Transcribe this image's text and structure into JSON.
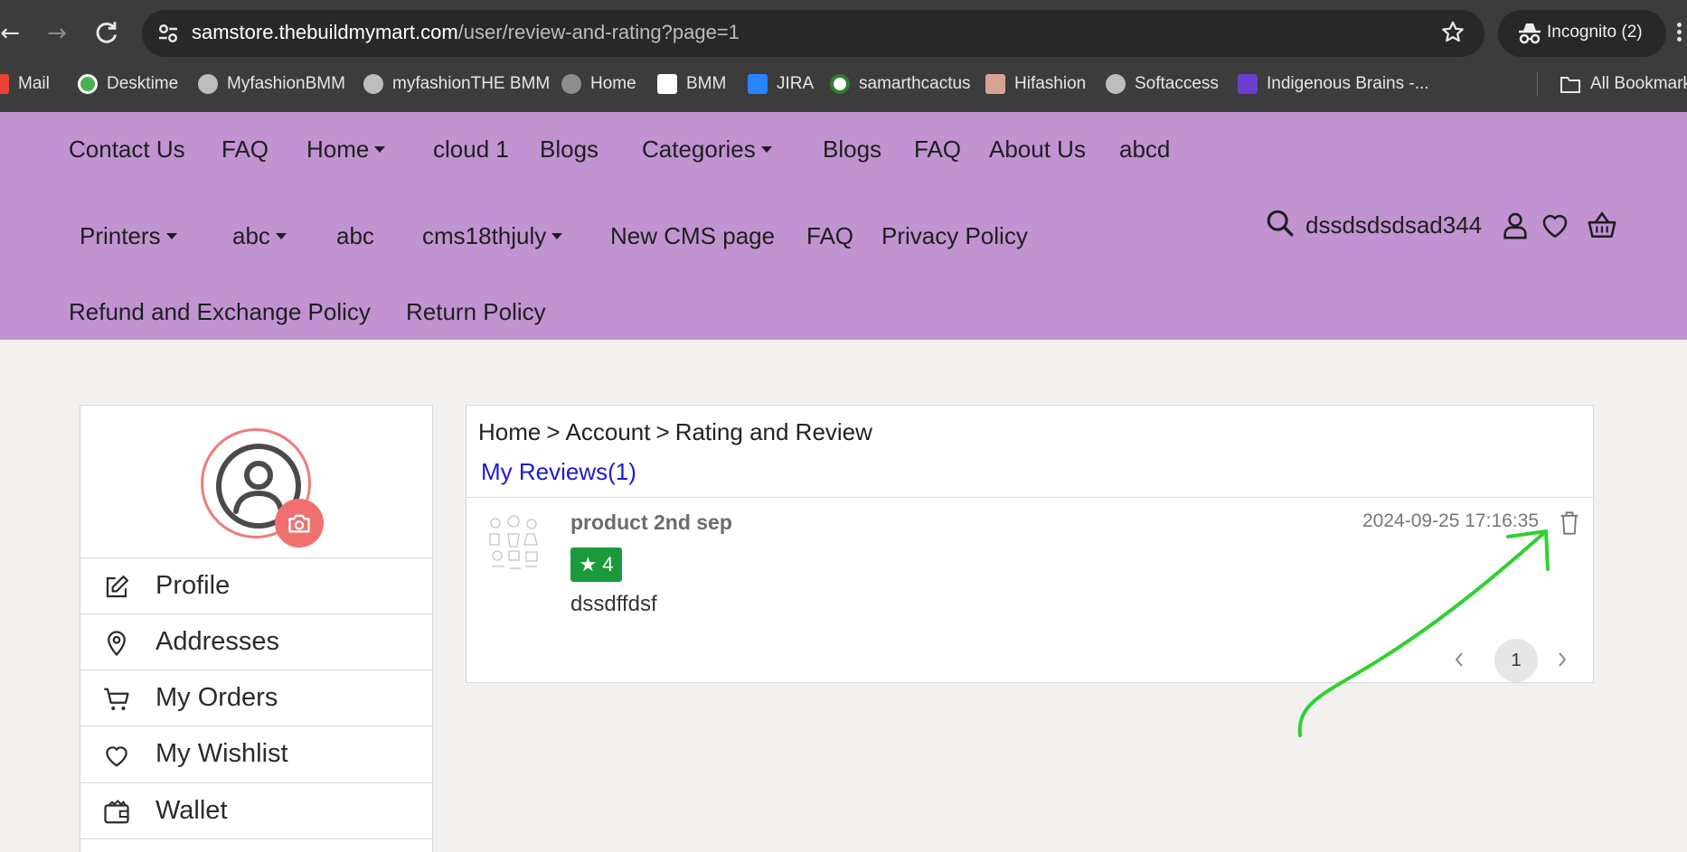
{
  "browser": {
    "url_host": "samstore.thebuildmymart.com",
    "url_path": "/user/review-and-rating?page=1",
    "incognito_label": "Incognito (2)",
    "bookmarks": [
      "Mail",
      "Desktime",
      "MyfashionBMM",
      "myfashionTHE BMM",
      "Home",
      "BMM",
      "JIRA",
      "samarthcactus",
      "Hifashion",
      "Softaccess",
      "Indigenous Brains -...",
      "All Bookmarks"
    ]
  },
  "header": {
    "row1": [
      "Contact Us",
      "FAQ",
      "Home",
      "cloud 1",
      "Blogs",
      "Categories",
      "Blogs",
      "FAQ",
      "About Us",
      "abcd"
    ],
    "row2": [
      "Printers",
      "abc",
      "abc",
      "cms18thjuly",
      "New CMS page",
      "FAQ",
      "Privacy Policy"
    ],
    "row3": [
      "Refund and Exchange Policy",
      "Return Policy"
    ],
    "search_text": "dssdsdsdsad344",
    "colors": {
      "background": "#c193d1"
    }
  },
  "sidebar": {
    "items": [
      {
        "label": "Profile",
        "icon": "edit-icon"
      },
      {
        "label": "Addresses",
        "icon": "location-pin-icon"
      },
      {
        "label": "My Orders",
        "icon": "cart-icon"
      },
      {
        "label": "My Wishlist",
        "icon": "heart-icon"
      },
      {
        "label": "Wallet",
        "icon": "wallet-icon"
      }
    ]
  },
  "main": {
    "breadcrumb": [
      "Home",
      "Account",
      "Rating and Review"
    ],
    "breadcrumb_sep": ">",
    "section_title": "My Reviews(1)",
    "reviews": [
      {
        "product": "product 2nd sep",
        "rating": "4",
        "text": "dssdffdsf",
        "date": "2024-09-25 17:16:35"
      }
    ],
    "pagination": {
      "current": "1"
    },
    "colors": {
      "rating_badge": "#1a9a3a",
      "link": "#1b1bd6"
    }
  }
}
